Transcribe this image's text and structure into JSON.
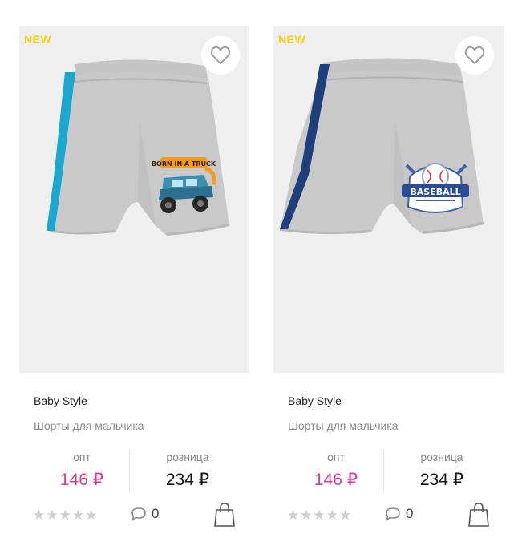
{
  "products": [
    {
      "badge": "NEW",
      "brand": "Baby Style",
      "title": "Шорты для мальчика",
      "prices": {
        "wholesale_label": "опт",
        "wholesale_value": "146 ₽",
        "retail_label": "розница",
        "retail_value": "234 ₽"
      },
      "rating": 0,
      "rating_max": 5,
      "comments": "0",
      "image": {
        "stripe_color": "#1aa7d0",
        "print": "monster-truck",
        "print_text": "BORN IN A TRUCK"
      }
    },
    {
      "badge": "NEW",
      "brand": "Baby Style",
      "title": "Шорты для мальчика",
      "prices": {
        "wholesale_label": "опт",
        "wholesale_value": "146 ₽",
        "retail_label": "розница",
        "retail_value": "234 ₽"
      },
      "rating": 0,
      "rating_max": 5,
      "comments": "0",
      "image": {
        "stripe_color": "#1f3f7a",
        "print": "baseball-badge",
        "print_text": "BASEBALL"
      }
    }
  ],
  "colors": {
    "badge": "#f5cf16",
    "wholesale_price": "#e23a8b",
    "star_empty": "#cfcfcf",
    "image_bg": "#efefef"
  },
  "icons": [
    "heart-icon",
    "star-icon",
    "comment-icon",
    "shopping-bag-icon"
  ]
}
